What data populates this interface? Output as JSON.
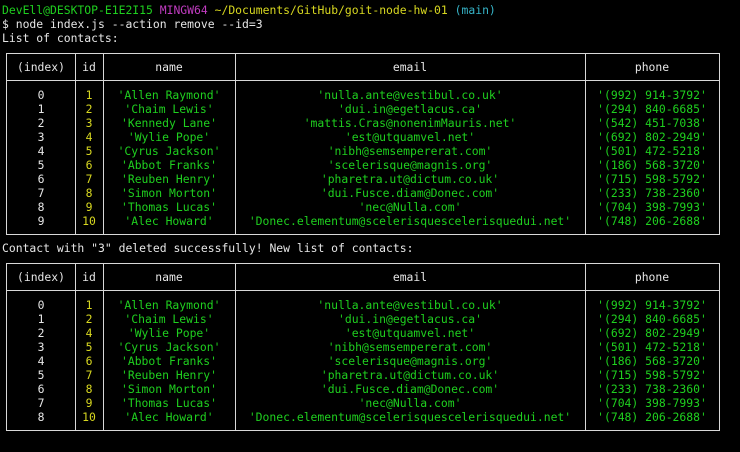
{
  "prompt": {
    "user_host": "DevEll@DESKTOP-E1E2I15",
    "shell": "MINGW64",
    "path": "~/Documents/GitHub/goit-node-hw-01",
    "branch": "(main)",
    "symbol": "$",
    "command": "node index.js --action remove --id=3"
  },
  "messages": {
    "list_title": "List of contacts:",
    "deleted_title": "Contact with \"3\" deleted successfully! New list of contacts:"
  },
  "table_headers": [
    "(index)",
    "id",
    "name",
    "email",
    "phone"
  ],
  "table1": [
    {
      "index": "0",
      "id": "1",
      "name": "'Allen Raymond'",
      "email": "'nulla.ante@vestibul.co.uk'",
      "phone": "'(992) 914-3792'"
    },
    {
      "index": "1",
      "id": "2",
      "name": "'Chaim Lewis'",
      "email": "'dui.in@egetlacus.ca'",
      "phone": "'(294) 840-6685'"
    },
    {
      "index": "2",
      "id": "3",
      "name": "'Kennedy Lane'",
      "email": "'mattis.Cras@nonenimMauris.net'",
      "phone": "'(542) 451-7038'"
    },
    {
      "index": "3",
      "id": "4",
      "name": "'Wylie Pope'",
      "email": "'est@utquamvel.net'",
      "phone": "'(692) 802-2949'"
    },
    {
      "index": "4",
      "id": "5",
      "name": "'Cyrus Jackson'",
      "email": "'nibh@semsempererat.com'",
      "phone": "'(501) 472-5218'"
    },
    {
      "index": "5",
      "id": "6",
      "name": "'Abbot Franks'",
      "email": "'scelerisque@magnis.org'",
      "phone": "'(186) 568-3720'"
    },
    {
      "index": "6",
      "id": "7",
      "name": "'Reuben Henry'",
      "email": "'pharetra.ut@dictum.co.uk'",
      "phone": "'(715) 598-5792'"
    },
    {
      "index": "7",
      "id": "8",
      "name": "'Simon Morton'",
      "email": "'dui.Fusce.diam@Donec.com'",
      "phone": "'(233) 738-2360'"
    },
    {
      "index": "8",
      "id": "9",
      "name": "'Thomas Lucas'",
      "email": "'nec@Nulla.com'",
      "phone": "'(704) 398-7993'"
    },
    {
      "index": "9",
      "id": "10",
      "name": "'Alec Howard'",
      "email": "'Donec.elementum@scelerisquescelerisquedui.net'",
      "phone": "'(748) 206-2688'"
    }
  ],
  "table2": [
    {
      "index": "0",
      "id": "1",
      "name": "'Allen Raymond'",
      "email": "'nulla.ante@vestibul.co.uk'",
      "phone": "'(992) 914-3792'"
    },
    {
      "index": "1",
      "id": "2",
      "name": "'Chaim Lewis'",
      "email": "'dui.in@egetlacus.ca'",
      "phone": "'(294) 840-6685'"
    },
    {
      "index": "2",
      "id": "4",
      "name": "'Wylie Pope'",
      "email": "'est@utquamvel.net'",
      "phone": "'(692) 802-2949'"
    },
    {
      "index": "3",
      "id": "5",
      "name": "'Cyrus Jackson'",
      "email": "'nibh@semsempererat.com'",
      "phone": "'(501) 472-5218'"
    },
    {
      "index": "4",
      "id": "6",
      "name": "'Abbot Franks'",
      "email": "'scelerisque@magnis.org'",
      "phone": "'(186) 568-3720'"
    },
    {
      "index": "5",
      "id": "7",
      "name": "'Reuben Henry'",
      "email": "'pharetra.ut@dictum.co.uk'",
      "phone": "'(715) 598-5792'"
    },
    {
      "index": "6",
      "id": "8",
      "name": "'Simon Morton'",
      "email": "'dui.Fusce.diam@Donec.com'",
      "phone": "'(233) 738-2360'"
    },
    {
      "index": "7",
      "id": "9",
      "name": "'Thomas Lucas'",
      "email": "'nec@Nulla.com'",
      "phone": "'(704) 398-7993'"
    },
    {
      "index": "8",
      "id": "10",
      "name": "'Alec Howard'",
      "email": "'Donec.elementum@scelerisquescelerisquedui.net'",
      "phone": "'(748) 206-2688'"
    }
  ],
  "colors": {
    "background": "#000000",
    "text": "#e6e6e6",
    "user_host": "#1fd01f",
    "shell": "#c13cc1",
    "path": "#d8d820",
    "branch": "#36b4c8",
    "number": "#d8d820",
    "string": "#1fd01f",
    "border": "#d8d8d8"
  }
}
